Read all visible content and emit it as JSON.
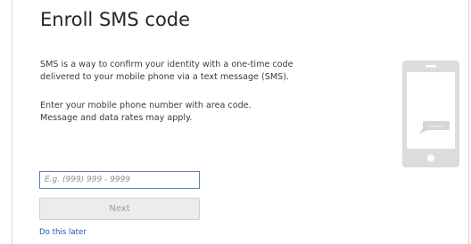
{
  "dialog": {
    "title": "Enroll SMS code",
    "description_lines": [
      "SMS is a way to confirm your identity with a one-time code",
      "delivered to your mobile phone via a text message (SMS)."
    ],
    "instruction_lines": [
      "Enter your mobile phone number with area code.",
      "Message and data rates may apply."
    ]
  },
  "phone_field": {
    "value": "",
    "placeholder": "E.g. (999) 999 - 9999"
  },
  "next_button": {
    "label": "Next",
    "enabled": false
  },
  "skip_link": {
    "label": "Do this later"
  },
  "illustration": {
    "icon": "smartphone-sms-icon",
    "bubble_text": "xxxxxxx"
  },
  "colors": {
    "link": "#1e58b2",
    "input_border": "#5d7fb0",
    "button_background": "#ececec",
    "button_text": "#9d9d9d",
    "illustration": "#dcdcdc"
  }
}
